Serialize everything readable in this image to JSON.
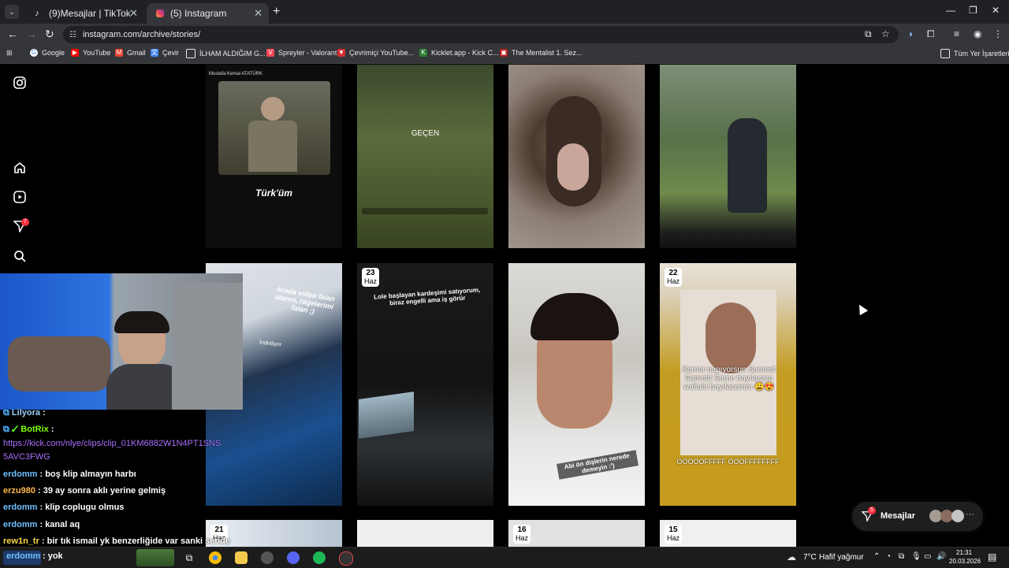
{
  "browser": {
    "tabs": [
      {
        "title": "(9)Mesajlar | TikTok",
        "icon": "tiktok-icon"
      },
      {
        "title": "(5) Instagram",
        "icon": "instagram-icon"
      }
    ],
    "url": "instagram.com/archive/stories/",
    "bookmarks": [
      {
        "label": "Google"
      },
      {
        "label": "YouTube"
      },
      {
        "label": "Gmail"
      },
      {
        "label": "Çevir"
      },
      {
        "label": "İLHAM ALDIĞIM G..."
      },
      {
        "label": "Spreyler - Valorant"
      },
      {
        "label": "Çevrimiçi YouTube..."
      },
      {
        "label": "Kicklet.app - Kick C..."
      },
      {
        "label": "The Mentalist 1. Sez..."
      }
    ],
    "bookmarks_all": "Tüm Yer İşaretleri",
    "accent": "#8ab4f8"
  },
  "sidebar": {
    "notification_count": "7"
  },
  "stories": {
    "row1": [
      {
        "top_text": "Mustafa Kemal ATATÜRK",
        "caption": "Türk'üm"
      },
      {
        "caption": "GEÇEN"
      },
      {},
      {}
    ],
    "row2": [
      {
        "caption": "Arada video falan atarım, rageler​imi falan ;)",
        "sub": "İndiriliyor"
      },
      {
        "day": "23",
        "month": "Haz",
        "caption": "Lole başlayan kardeşimi satıyorum, biraz engelli ama iş görür"
      },
      {
        "caption": "Abi ön dişlerin nerede demeyin :')"
      },
      {
        "day": "22",
        "month": "Haz",
        "caption": "Samet napıyorsun Sameet Samettt Same bayılacam wallahi bayılacamm 😩😍",
        "caption2": "OOOOOFFFFF OOOFFFFFFFF"
      }
    ],
    "row3": [
      {
        "day": "21",
        "month": "Haz"
      },
      {},
      {
        "day": "16",
        "month": "Haz"
      },
      {
        "day": "15",
        "month": "Haz"
      }
    ]
  },
  "chat": [
    {
      "user": "Lilyora",
      "text": ":",
      "color": "#9ad4ff"
    },
    {
      "user": "BotRix",
      "text": ":",
      "color": "#7cfc00"
    },
    {
      "user": "",
      "text": "https://kick.com/nlye/clips/clip_01KM6882W1N4PT1SNS",
      "color": "#a970ff"
    },
    {
      "user": "",
      "text": "5AVC3FWG",
      "color": "#a970ff"
    },
    {
      "user": "erdomm",
      "text": ": boş klip almayın harbı",
      "color": "#6ec0ff"
    },
    {
      "user": "erzu980",
      "text": ": 39 ay sonra aklı yerine gelmiş",
      "color": "#ffb84d"
    },
    {
      "user": "erdomm",
      "text": ": klip coplugu olmus",
      "color": "#6ec0ff"
    },
    {
      "user": "erdomm",
      "text": ": kanal aq",
      "color": "#6ec0ff"
    },
    {
      "user": "rew1n_tr",
      "text": ": bir tık ismail yk benzerliğide var sanki sende",
      "color": "#ffd84d"
    },
    {
      "user": "erdomm",
      "text": ": yok",
      "color": "#6ec0ff"
    }
  ],
  "messages_widget": {
    "label": "Mesajlar",
    "badge": "5"
  },
  "taskbar": {
    "weather_temp": "7°C",
    "weather_text": "Hafif yağmur",
    "time": "21:31",
    "date": "20.03.2026"
  }
}
